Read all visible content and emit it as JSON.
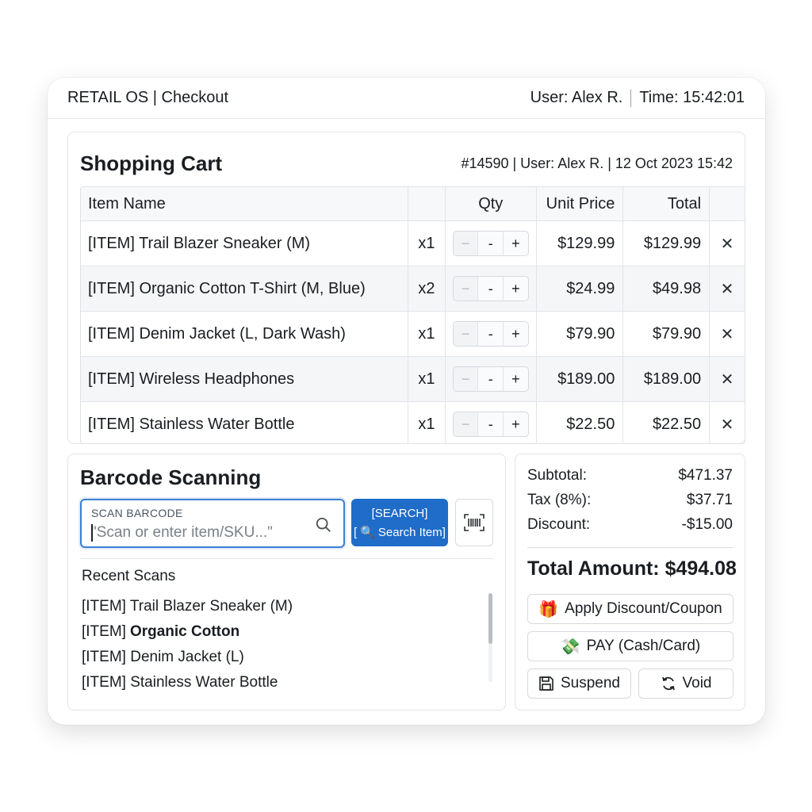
{
  "titlebar": {
    "app_title": "RETAIL OS | Checkout",
    "user": "User: Alex R.",
    "time": "Time: 15:42:01"
  },
  "cart": {
    "title": "Shopping Cart",
    "meta": "#14590 | User: Alex R. | 12 Oct 2023 15:42",
    "columns": {
      "name": "Item Name",
      "qty": "Qty",
      "unit_price": "Unit Price",
      "total": "Total"
    },
    "stepper": {
      "minus_disabled": "−",
      "minus": "-",
      "plus": "+"
    },
    "items": [
      {
        "name": "[ITEM] Trail Blazer Sneaker (M)",
        "qty": "x1",
        "unit_price": "$129.99",
        "total": "$129.99"
      },
      {
        "name": "[ITEM] Organic Cotton T-Shirt (M, Blue)",
        "qty": "x2",
        "unit_price": "$24.99",
        "total": "$49.98"
      },
      {
        "name": "[ITEM] Denim Jacket (L, Dark Wash)",
        "qty": "x1",
        "unit_price": "$79.90",
        "total": "$79.90"
      },
      {
        "name": "[ITEM] Wireless Headphones",
        "qty": "x1",
        "unit_price": "$189.00",
        "total": "$189.00"
      },
      {
        "name": "[ITEM] Stainless Water Bottle",
        "qty": "x1",
        "unit_price": "$22.50",
        "total": "$22.50"
      }
    ]
  },
  "scan": {
    "title": "Barcode Scanning",
    "input_label": "SCAN BARCODE",
    "input_placeholder": "\"Scan or enter item/SKU...\"",
    "search_button_top": "[SEARCH]",
    "search_button_label": "Search Item]",
    "search_button_bracket": "[",
    "recent_title": "Recent Scans",
    "recent": [
      {
        "prefix": "[ITEM] Trail Blazer Sneaker (M)",
        "bold": ""
      },
      {
        "prefix": "[ITEM]",
        "bold": "Organic Cotton"
      },
      {
        "prefix": "[ITEM] Denim Jacket (L)",
        "bold": ""
      },
      {
        "prefix": "[ITEM] Stainless Water Bottle",
        "bold": ""
      }
    ]
  },
  "summary": {
    "subtotal_label": "Subtotal:",
    "subtotal": "$471.37",
    "tax_label": "Tax (8%):",
    "tax": "$37.71",
    "discount_label": "Discount:",
    "discount": "-$15.00",
    "total": "Total Amount: $494.08",
    "apply_discount": "Apply Discount/Coupon",
    "pay": "PAY (Cash/Card)",
    "suspend": "Suspend",
    "void": "Void"
  },
  "colors": {
    "accent": "#1f6cc9",
    "focus_border": "#3b7fd4"
  },
  "icons": [
    "search-icon",
    "barcode-icon",
    "gift-icon",
    "money-icon",
    "save-icon",
    "refresh-icon",
    "close-icon",
    "magnifier-icon"
  ]
}
